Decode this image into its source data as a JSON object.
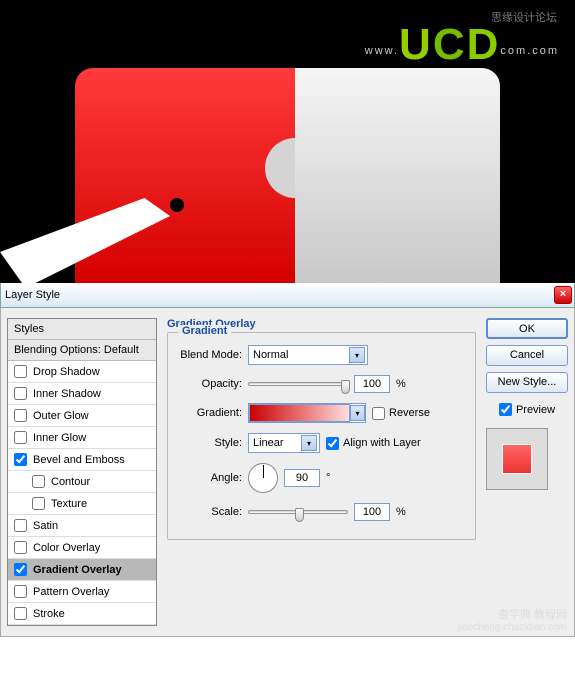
{
  "banner": {
    "overlay_text": "思缘设计论坛",
    "www": "www.",
    "u": "U",
    "c": "C",
    "d": "D",
    "com1": "com",
    "com2": ".com"
  },
  "dialog": {
    "title": "Layer Style"
  },
  "styles": {
    "header": "Styles",
    "blending": "Blending Options: Default",
    "items": [
      {
        "label": "Drop Shadow",
        "checked": false,
        "selected": false,
        "indent": false
      },
      {
        "label": "Inner Shadow",
        "checked": false,
        "selected": false,
        "indent": false
      },
      {
        "label": "Outer Glow",
        "checked": false,
        "selected": false,
        "indent": false
      },
      {
        "label": "Inner Glow",
        "checked": false,
        "selected": false,
        "indent": false
      },
      {
        "label": "Bevel and Emboss",
        "checked": true,
        "selected": false,
        "indent": false
      },
      {
        "label": "Contour",
        "checked": false,
        "selected": false,
        "indent": true
      },
      {
        "label": "Texture",
        "checked": false,
        "selected": false,
        "indent": true
      },
      {
        "label": "Satin",
        "checked": false,
        "selected": false,
        "indent": false
      },
      {
        "label": "Color Overlay",
        "checked": false,
        "selected": false,
        "indent": false
      },
      {
        "label": "Gradient Overlay",
        "checked": true,
        "selected": true,
        "indent": false
      },
      {
        "label": "Pattern Overlay",
        "checked": false,
        "selected": false,
        "indent": false
      },
      {
        "label": "Stroke",
        "checked": false,
        "selected": false,
        "indent": false
      }
    ]
  },
  "gradient": {
    "section_title": "Gradient Overlay",
    "group_label": "Gradient",
    "blend_mode_label": "Blend Mode:",
    "blend_mode_value": "Normal",
    "opacity_label": "Opacity:",
    "opacity_value": "100",
    "percent": "%",
    "gradient_label": "Gradient:",
    "reverse_label": "Reverse",
    "reverse_checked": false,
    "style_label": "Style:",
    "style_value": "Linear",
    "align_label": "Align with Layer",
    "align_checked": true,
    "angle_label": "Angle:",
    "angle_value": "90",
    "degree": "°",
    "scale_label": "Scale:",
    "scale_value": "100"
  },
  "buttons": {
    "ok": "OK",
    "cancel": "Cancel",
    "new_style": "New Style...",
    "preview": "Preview",
    "preview_checked": true
  },
  "watermark": {
    "line1": "查字典 教程网",
    "line2": "jiaocheng.chazidian.com"
  }
}
